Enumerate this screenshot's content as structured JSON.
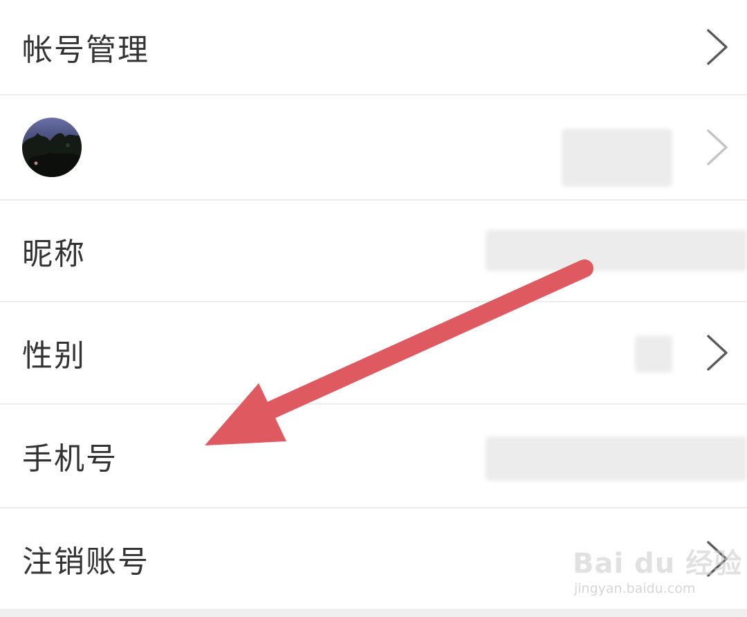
{
  "account_menu": {
    "items": [
      {
        "label": "帐号管理",
        "has_chevron": true
      },
      {
        "label": "",
        "kind": "avatar",
        "has_chevron": true
      },
      {
        "label": "昵称",
        "has_chevron": false
      },
      {
        "label": "性别",
        "has_chevron": true
      },
      {
        "label": "手机号",
        "has_chevron": false
      },
      {
        "label": "注销账号",
        "has_chevron": true
      }
    ]
  },
  "annotation": {
    "arrow_color": "#de5a60"
  },
  "watermark": {
    "brand": "Bai du 经验",
    "url": "jingyan.baidu.com"
  },
  "colors": {
    "text": "#333333",
    "divider": "#ececec",
    "chevron": "#5a5a5a",
    "redacted": "#ececec"
  }
}
